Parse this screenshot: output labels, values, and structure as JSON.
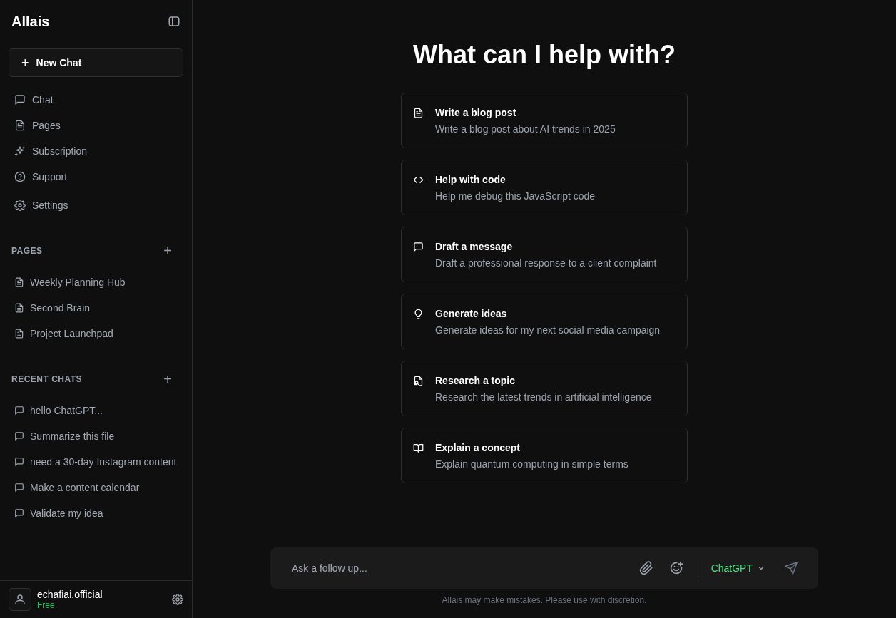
{
  "sidebar": {
    "brand": "Allais",
    "new_chat": {
      "icon_text": "+",
      "label": "New Chat"
    },
    "nav": [
      {
        "kind": "chat",
        "label": "Chat"
      },
      {
        "kind": "page",
        "label": "Pages"
      },
      {
        "kind": "sparkle",
        "label": "Subscription"
      },
      {
        "kind": "help",
        "label": "Support"
      },
      {
        "kind": "settings",
        "label": "Settings"
      }
    ],
    "sections": [
      {
        "title": "PAGES",
        "add": "+",
        "kind": "page",
        "items": [
          "Weekly Planning Hub",
          "Second Brain",
          "Project Launchpad"
        ]
      },
      {
        "title": "RECENT CHATS",
        "add": "+",
        "kind": "chat",
        "items": [
          "hello ChatGPT...",
          "Summarize this file",
          "need a 30-day Instagram content",
          "Make a content calendar",
          "Validate my idea"
        ]
      }
    ],
    "user": {
      "name": "echafiai.official",
      "plan": "Free"
    }
  },
  "main": {
    "heading": "What can I help with?",
    "suggestions": [
      {
        "kind": "document",
        "title": "Write a blog post",
        "prompt": "Write a blog post about AI trends in 2025"
      },
      {
        "kind": "code",
        "title": "Help with code",
        "prompt": "Help me debug this JavaScript code"
      },
      {
        "kind": "chat",
        "title": "Draft a message",
        "prompt": "Draft a professional response to a client complaint"
      },
      {
        "kind": "bulb",
        "title": "Generate ideas",
        "prompt": "Generate ideas for my next social media campaign"
      },
      {
        "kind": "search-file",
        "title": "Research a topic",
        "prompt": "Research the latest trends in artificial intelligence"
      },
      {
        "kind": "book",
        "title": "Explain a concept",
        "prompt": "Explain quantum computing in simple terms"
      }
    ],
    "composer": {
      "placeholder": "Ask a follow up...",
      "model": "ChatGPT"
    },
    "disclaimer": "Allais may make mistakes. Please use with discretion."
  }
}
